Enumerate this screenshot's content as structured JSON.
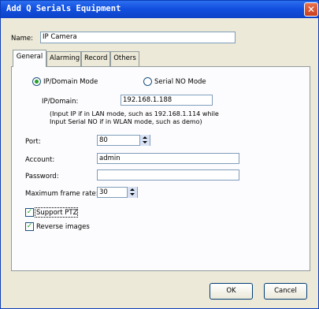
{
  "dialog": {
    "title": "Add Q Serials Equipment"
  },
  "name_field": {
    "label": "Name:",
    "value": "IP Camera"
  },
  "tabs": [
    {
      "label": "General",
      "active": true
    },
    {
      "label": "Alarming"
    },
    {
      "label": "Record"
    },
    {
      "label": "Others"
    }
  ],
  "general": {
    "mode_ip": {
      "label": "IP/Domain Mode",
      "selected": true
    },
    "mode_serial": {
      "label": "Serial NO Mode",
      "selected": false
    },
    "ip_domain": {
      "label": "IP/Domain:",
      "value": "192.168.1.188"
    },
    "hint_line1": "(Input IP if in LAN mode, such as 192.168.1.114 while",
    "hint_line2": "Input Serial NO if in WLAN mode, such as demo)",
    "port": {
      "label": "Port:",
      "value": "80"
    },
    "account": {
      "label": "Account:",
      "value": "admin"
    },
    "password": {
      "label": "Password:",
      "value": ""
    },
    "frame_rate": {
      "label": "Maximum frame rate:",
      "value": "30"
    },
    "support_ptz": {
      "label": "Support PTZ",
      "checked": true
    },
    "reverse_images": {
      "label": "Reverse images",
      "checked": true
    }
  },
  "buttons": {
    "ok": "OK",
    "cancel": "Cancel"
  }
}
